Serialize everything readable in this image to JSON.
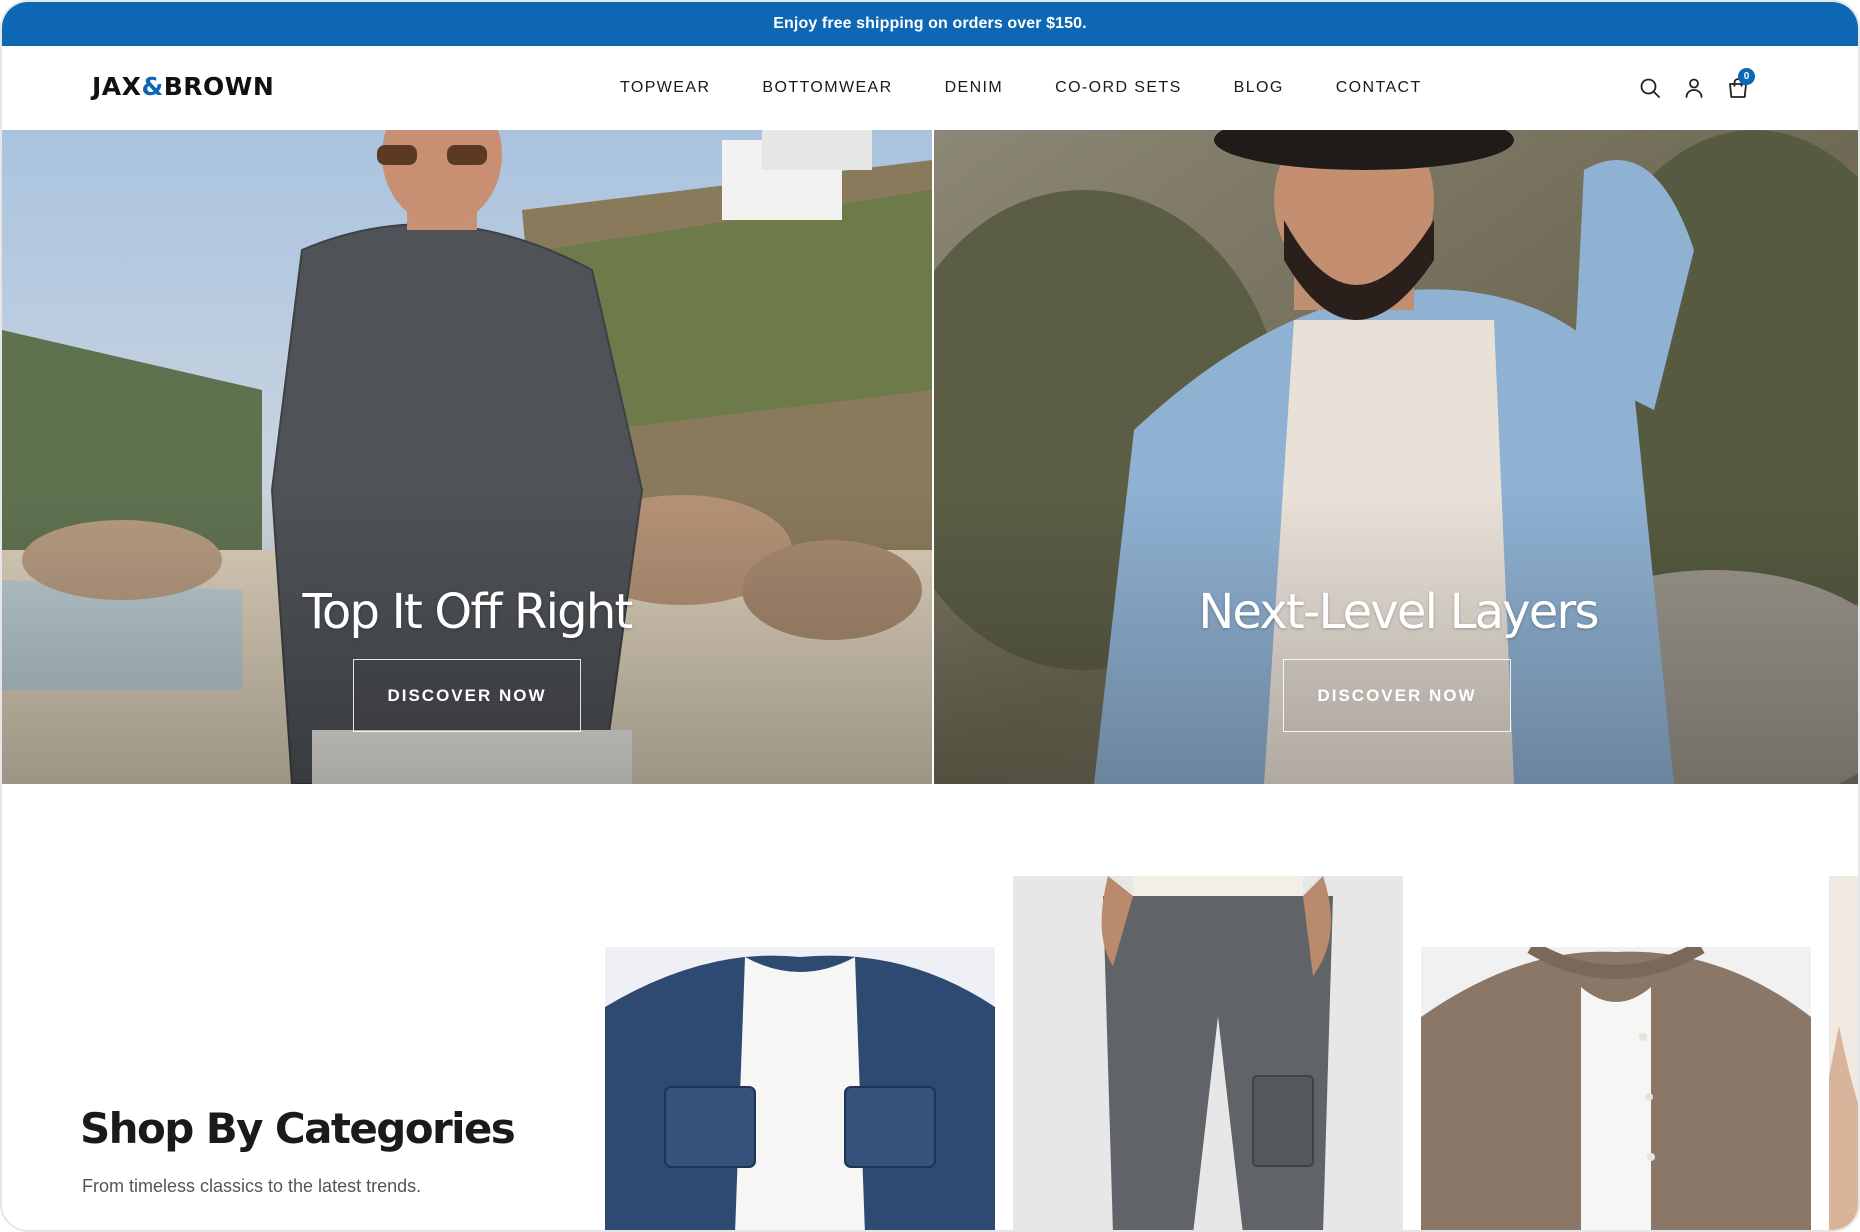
{
  "announcement": {
    "text": "Enjoy free shipping on orders over $150."
  },
  "brand": {
    "left": "JAX",
    "amp": "&",
    "right": "BROWN"
  },
  "nav": {
    "items": [
      "TOPWEAR",
      "BOTTOMWEAR",
      "DENIM",
      "CO-ORD SETS",
      "BLOG",
      "CONTACT"
    ]
  },
  "header_icons": {
    "search": "search-icon",
    "account": "user-icon",
    "cart": "shopping-bag-icon",
    "cart_count": "0"
  },
  "hero": {
    "left": {
      "title": "Top It Off Right",
      "button": "DISCOVER NOW"
    },
    "right": {
      "title": "Next-Level Layers",
      "button": "DISCOVER NOW"
    }
  },
  "categories": {
    "title": "Shop By Categories",
    "subtitle": "From timeless classics to the latest trends."
  },
  "colors": {
    "accent": "#0e67b3"
  }
}
